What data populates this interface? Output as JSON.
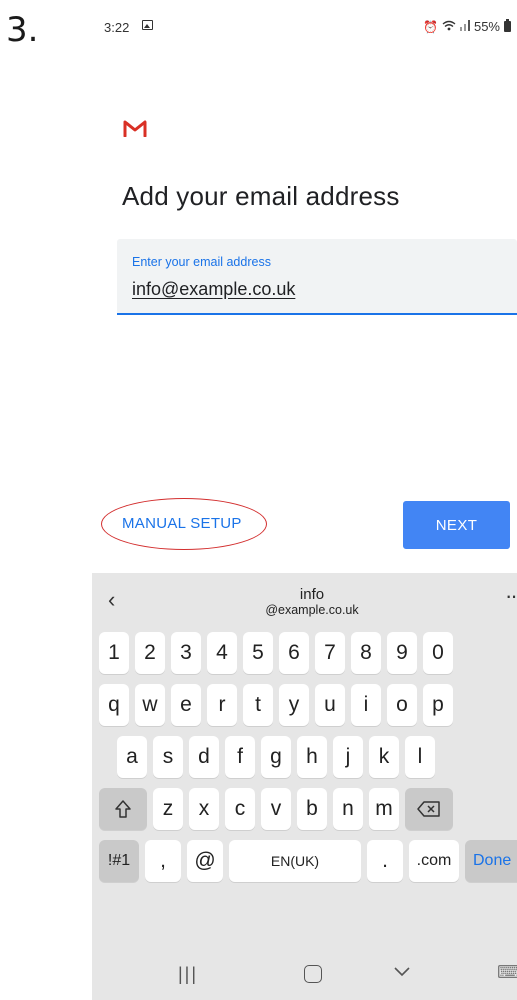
{
  "step": {
    "number": "3."
  },
  "status_bar": {
    "time": "3:22",
    "battery": "55%"
  },
  "app": {
    "title": "Add your email address"
  },
  "email_field": {
    "label": "Enter your email address",
    "value": "info@example.co.uk"
  },
  "actions": {
    "manual_setup": "MANUAL SETUP",
    "next": "NEXT"
  },
  "keyboard": {
    "suggestion_main": "info",
    "suggestion_sub": "@example.co.uk",
    "number_row": [
      "1",
      "2",
      "3",
      "4",
      "5",
      "6",
      "7",
      "8",
      "9",
      "0"
    ],
    "row1": [
      "q",
      "w",
      "e",
      "r",
      "t",
      "y",
      "u",
      "i",
      "o",
      "p"
    ],
    "row2": [
      "a",
      "s",
      "d",
      "f",
      "g",
      "h",
      "j",
      "k",
      "l"
    ],
    "row3": [
      "z",
      "x",
      "c",
      "v",
      "b",
      "n",
      "m"
    ],
    "symbols_key": "!#1",
    "comma_key": ",",
    "at_key": "@",
    "space_key": "EN(UK)",
    "period_key": ".",
    "com_key": ".com",
    "done_key": "Done"
  },
  "colors": {
    "accent": "#1a73e8",
    "next_button": "#4285f4",
    "annotation": "#d32f2f",
    "keyboard_bg": "#e6e6e6"
  }
}
